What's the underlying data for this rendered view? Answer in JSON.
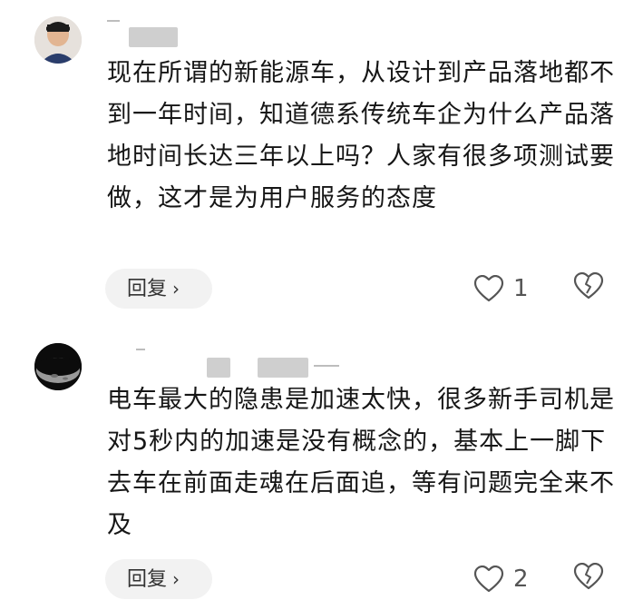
{
  "comments": [
    {
      "text": "现在所谓的新能源车，从设计到产品落地都不到一年时间，知道德系传统车企为什么产品落地时间长达三年以上吗？人家有很多项测试要做，这才是为用户服务的态度",
      "reply_label": "回复",
      "like_count": "1"
    },
    {
      "text": "电车最大的隐患是加速太快，很多新手司机是对5秒内的加速是没有概念的，基本上一脚下去车在前面走魂在后面追，等有问题完全来不及",
      "reply_label": "回复",
      "like_count": "2"
    }
  ],
  "icons": {
    "reply_chevron": "chevron-right-icon",
    "like": "heart-outline-icon",
    "dislike": "broken-heart-icon"
  }
}
